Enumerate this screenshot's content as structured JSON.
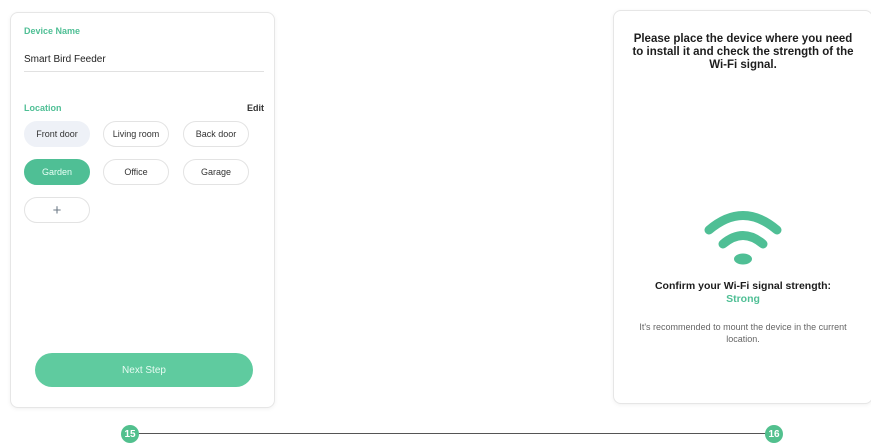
{
  "colors": {
    "accent": "#4fbf95",
    "button": "#5fcb9f",
    "chip_light": "#eef1f7"
  },
  "screen15": {
    "device_name_label": "Device Name",
    "device_name_value": "Smart Bird Feeder",
    "location_label": "Location",
    "edit_label": "Edit",
    "locations": [
      {
        "label": "Front door",
        "state": "light"
      },
      {
        "label": "Living room",
        "state": "default"
      },
      {
        "label": "Back door",
        "state": "default"
      },
      {
        "label": "Garden",
        "state": "selected"
      },
      {
        "label": "Office",
        "state": "default"
      },
      {
        "label": "Garage",
        "state": "default"
      }
    ],
    "add_label": "+",
    "add_icon": "plus-icon",
    "next_step_label": "Next Step"
  },
  "screen16": {
    "instruction": "Please place the device where you need to install it and check the strength of the Wi-Fi signal.",
    "wifi_icon": "wifi-icon",
    "confirm_prefix": "Confirm your Wi-Fi signal strength: ",
    "strength_value": "Strong",
    "recommendation": "It's recommended to mount the device in the current location."
  },
  "steps": {
    "first": "15",
    "second": "16"
  }
}
